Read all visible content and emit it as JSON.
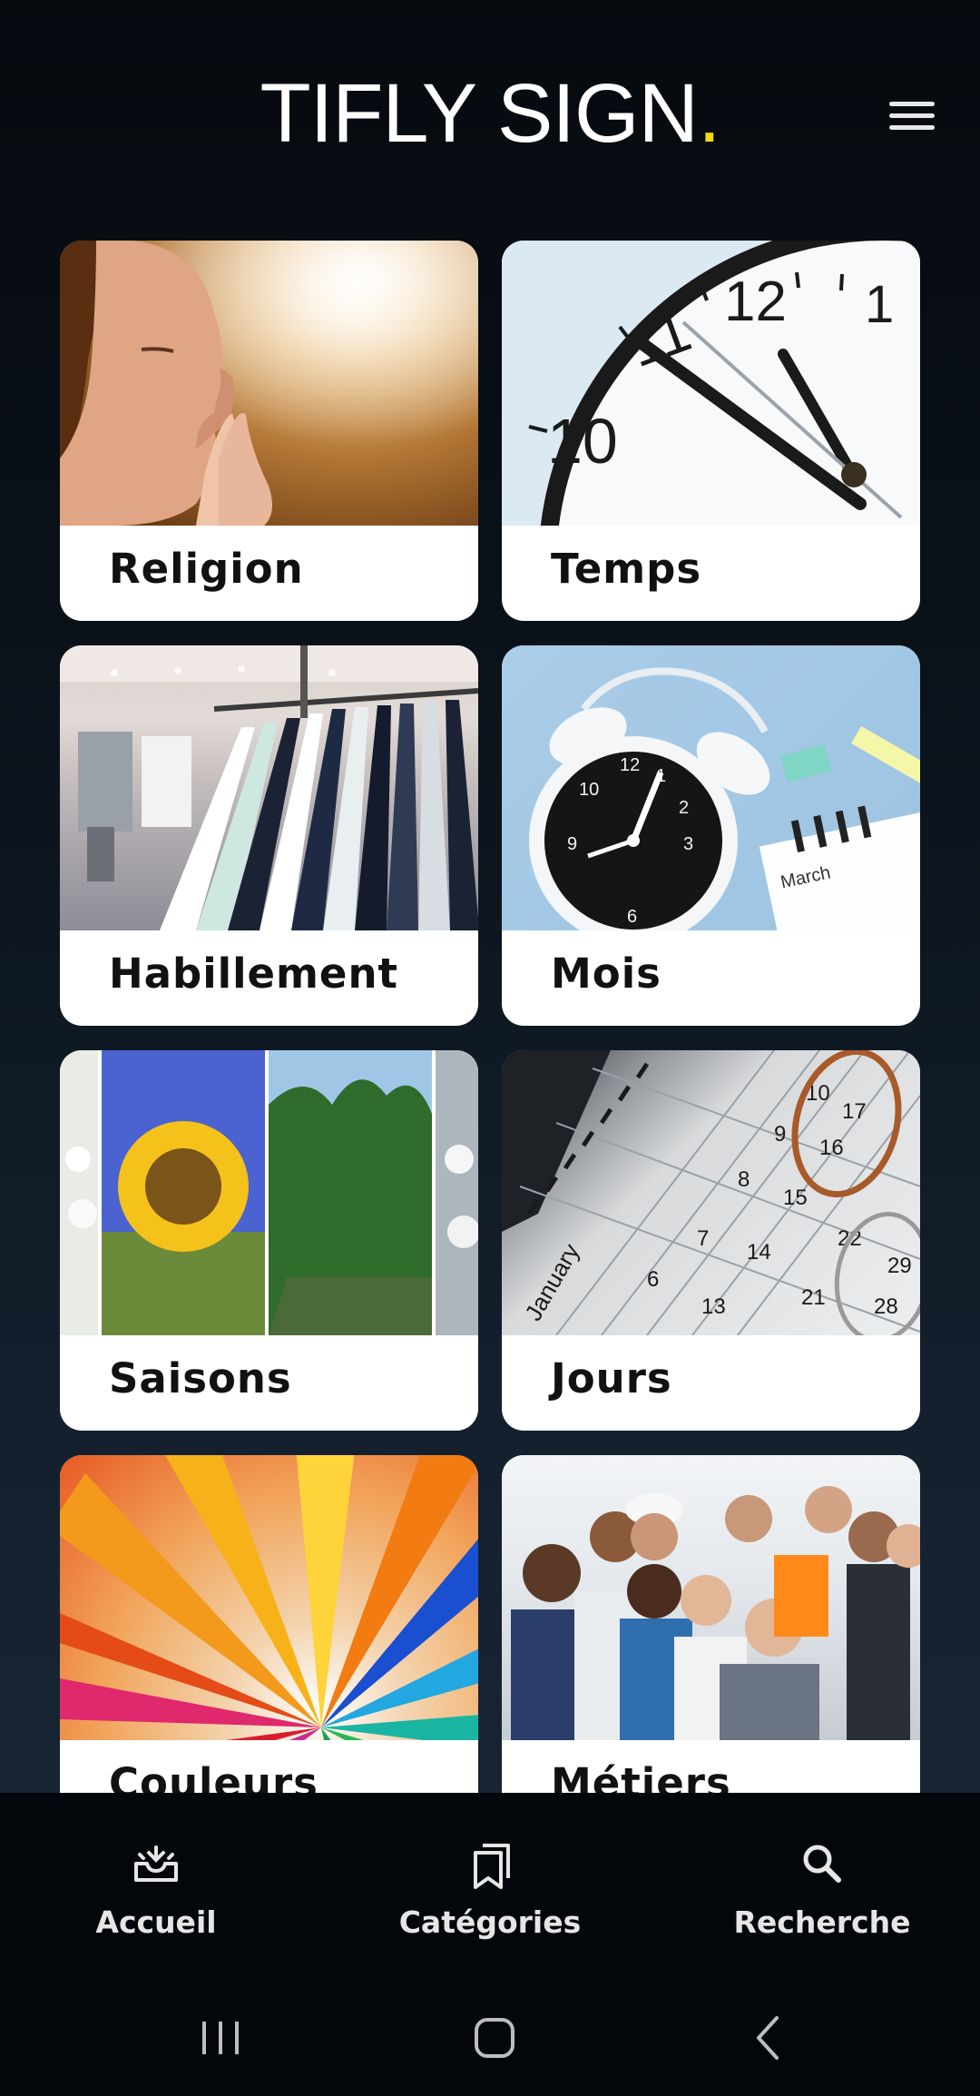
{
  "header": {
    "logo_text": "TIFLY SIGN",
    "logo_dot": ".",
    "menu_icon": "hamburger-menu-icon"
  },
  "colors": {
    "accent_dot": "#f5d90a",
    "background_top": "#060a0f",
    "background_bottom": "#1a2838",
    "card_bg": "#ffffff",
    "nav_bg": "#03060a"
  },
  "categories": [
    {
      "label": "Religion",
      "image": "praying-woman-photo"
    },
    {
      "label": "Temps",
      "image": "clock-photo"
    },
    {
      "label": "Habillement",
      "image": "clothing-rack-photo"
    },
    {
      "label": "Mois",
      "image": "alarm-clock-calendar-photo"
    },
    {
      "label": "Saisons",
      "image": "seasons-collage-photo"
    },
    {
      "label": "Jours",
      "image": "calendar-glasses-photo"
    },
    {
      "label": "Couleurs",
      "image": "colored-pencils-photo"
    },
    {
      "label": "Métiers",
      "image": "professions-group-photo"
    }
  ],
  "bottom_nav": [
    {
      "label": "Accueil",
      "icon": "inbox-home-icon"
    },
    {
      "label": "Catégories",
      "icon": "bookmarks-icon"
    },
    {
      "label": "Recherche",
      "icon": "search-icon"
    }
  ],
  "system_nav": {
    "recents_icon": "recent-apps-icon",
    "home_icon": "home-icon",
    "back_icon": "back-icon"
  }
}
